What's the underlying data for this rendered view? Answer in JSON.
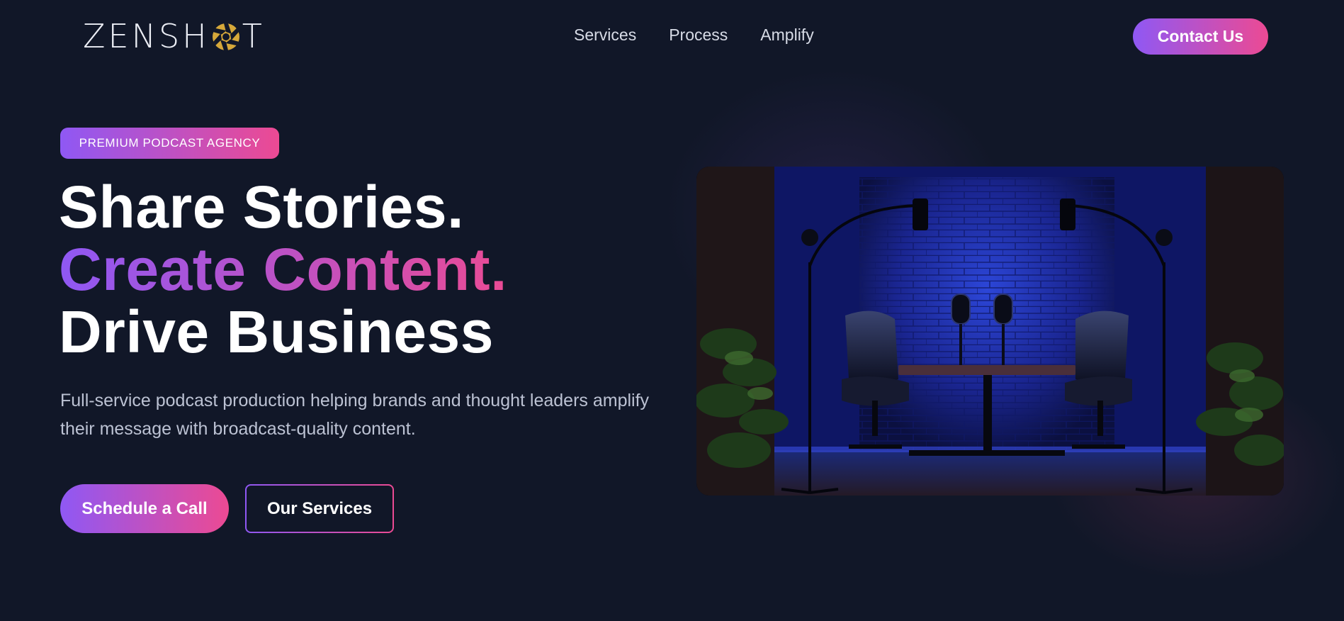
{
  "brand": {
    "logo_left": "ZENSH",
    "logo_right": "T",
    "accent_purple": "#8f58f4",
    "accent_pink": "#ec4a93",
    "logo_gold": "#d6a83a",
    "background": "#111728"
  },
  "nav": {
    "links": [
      {
        "label": "Services"
      },
      {
        "label": "Process"
      },
      {
        "label": "Amplify"
      }
    ],
    "contact_label": "Contact Us"
  },
  "hero": {
    "badge": "PREMIUM PODCAST AGENCY",
    "headline": {
      "line1": "Share Stories.",
      "line2": "Create Content.",
      "line3": "Drive Business"
    },
    "subtext": "Full-service podcast production helping brands and thought leaders amplify their message with broadcast-quality content.",
    "primary_cta": "Schedule a Call",
    "secondary_cta": "Our Services",
    "image_icon": "podcast-studio-photo"
  }
}
